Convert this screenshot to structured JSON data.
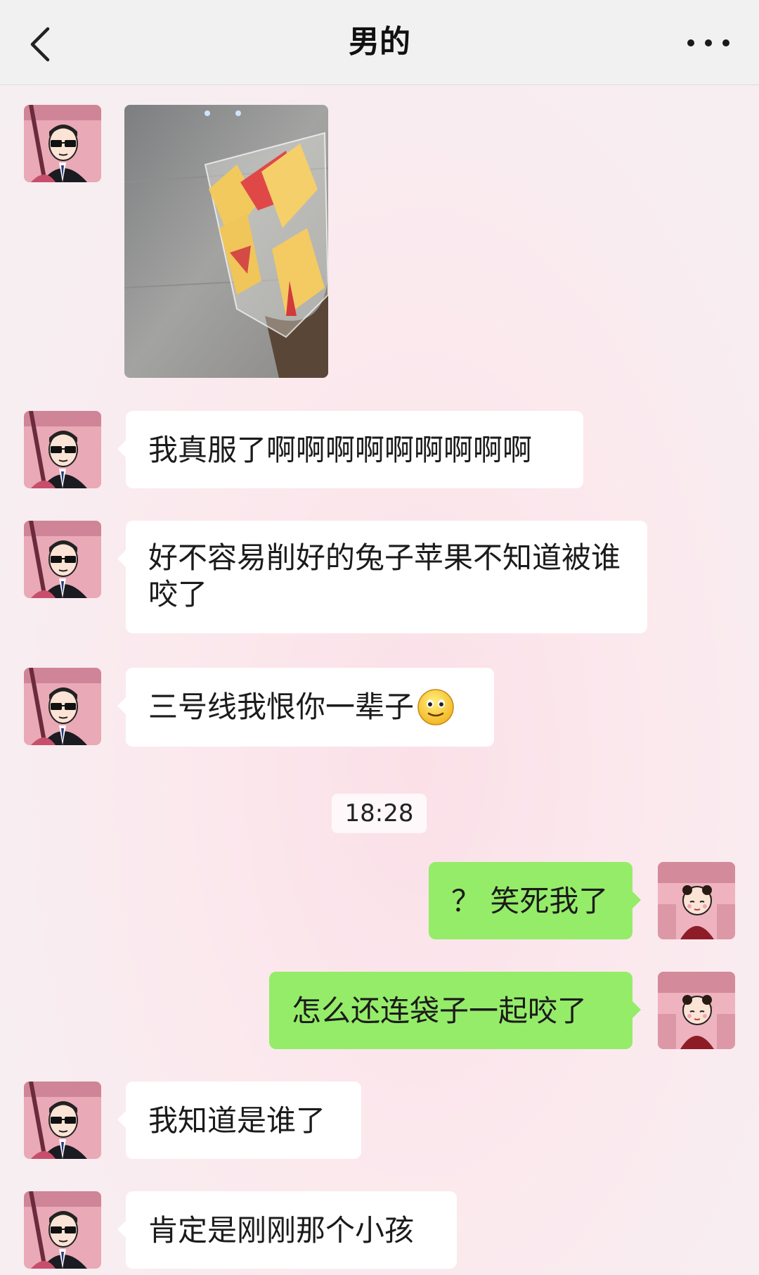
{
  "header": {
    "title": "男的"
  },
  "timestamp": "18:28",
  "messages": [
    {
      "text": "我真服了啊啊啊啊啊啊啊啊啊"
    },
    {
      "text": "好不容易削好的兔子苹果不知道被谁咬了"
    },
    {
      "text": "三号线我恨你一辈子"
    },
    {
      "text": "？ 笑死我了"
    },
    {
      "text": "怎么还连袋子一起咬了"
    },
    {
      "text": "我知道是谁了"
    },
    {
      "text": "肯定是刚刚那个小孩"
    }
  ],
  "icons": {
    "back": "chevron-left-icon",
    "more": "ellipsis-icon",
    "emoji": "slight-smile-emoji-icon"
  },
  "colors": {
    "incoming_bubble": "#ffffff",
    "outgoing_bubble": "#95ec69"
  }
}
